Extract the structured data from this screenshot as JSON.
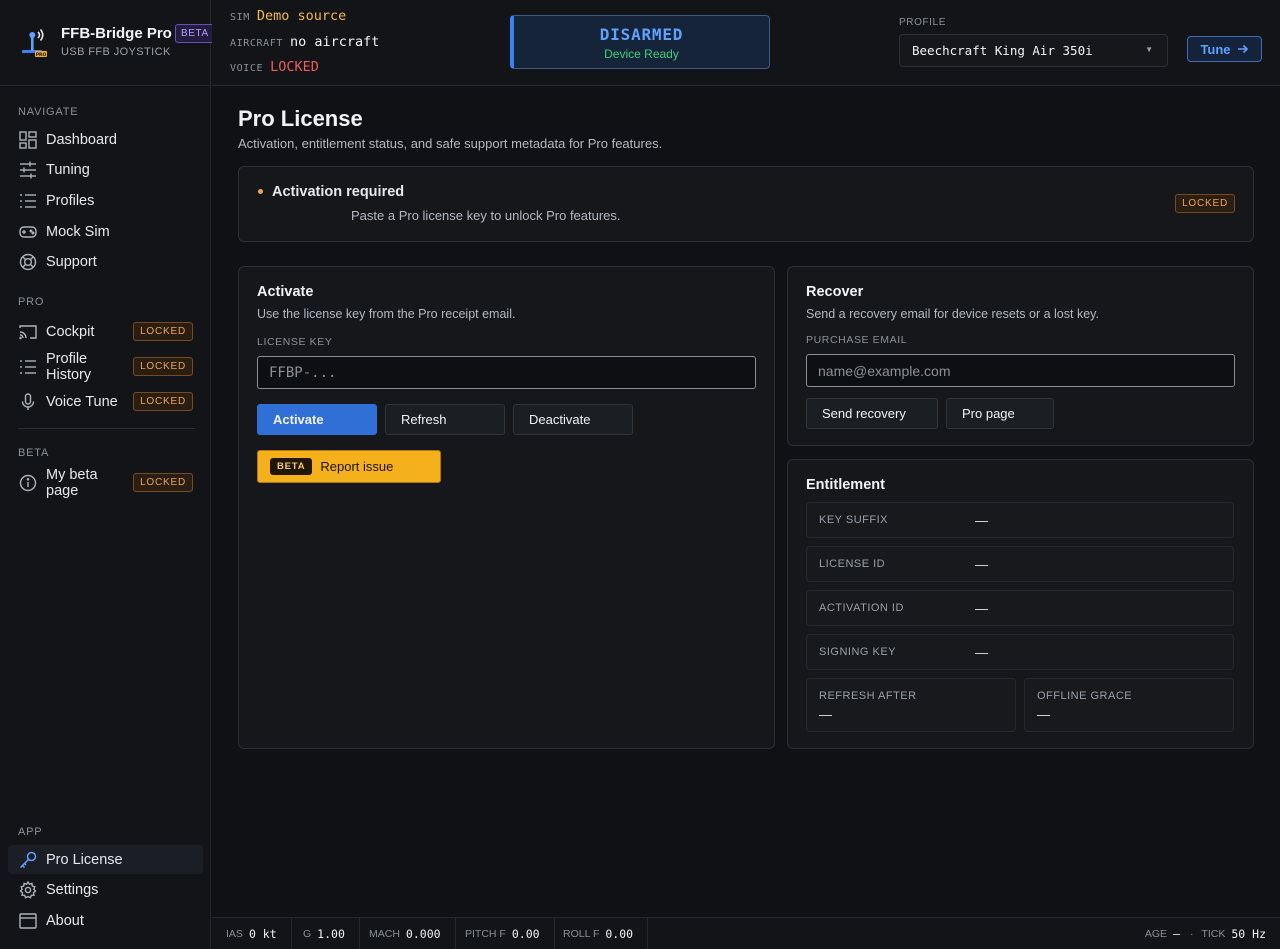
{
  "brand": {
    "name": "FFB-Bridge Pro",
    "badge": "BETA",
    "subtitle": "USB FFB JOYSTICK"
  },
  "sidebar": {
    "sections": {
      "navigate": "NAVIGATE",
      "pro": "PRO",
      "beta": "BETA",
      "app": "APP"
    },
    "navigate": [
      {
        "label": "Dashboard",
        "icon": "dashboard-icon"
      },
      {
        "label": "Tuning",
        "icon": "sliders-icon"
      },
      {
        "label": "Profiles",
        "icon": "list-icon"
      },
      {
        "label": "Mock Sim",
        "icon": "gamepad-icon"
      },
      {
        "label": "Support",
        "icon": "lifebuoy-icon"
      }
    ],
    "pro": [
      {
        "label": "Cockpit",
        "badge": "LOCKED",
        "icon": "cast-icon"
      },
      {
        "label": "Profile History",
        "badge": "LOCKED",
        "icon": "list-icon"
      },
      {
        "label": "Voice Tune",
        "badge": "LOCKED",
        "icon": "microphone-icon"
      }
    ],
    "beta": [
      {
        "label": "My beta page",
        "badge": "LOCKED",
        "icon": "info-icon"
      }
    ],
    "app": [
      {
        "label": "Pro License",
        "icon": "key-icon",
        "active": true
      },
      {
        "label": "Settings",
        "icon": "gear-icon"
      },
      {
        "label": "About",
        "icon": "window-icon"
      }
    ]
  },
  "topbar": {
    "sim_key": "SIM",
    "sim_value": "Demo source",
    "aircraft_key": "AIRCRAFT",
    "aircraft_value": "no aircraft",
    "voice_key": "VOICE",
    "voice_value": "LOCKED",
    "status": "DISARMED",
    "status_sub": "Device Ready",
    "profile_label": "PROFILE",
    "profile_value": "Beechcraft King Air 350i",
    "tune_label": "Tune"
  },
  "page": {
    "title": "Pro License",
    "subtitle": "Activation, entitlement status, and safe support metadata for Pro features."
  },
  "alert": {
    "title": "Activation required",
    "text": "Paste a Pro license key to unlock Pro features.",
    "badge": "LOCKED"
  },
  "activate": {
    "title": "Activate",
    "subtitle": "Use the license key from the Pro receipt email.",
    "field_label": "LICENSE KEY",
    "placeholder": "FFBP-...",
    "value": "",
    "buttons": {
      "activate": "Activate",
      "refresh": "Refresh",
      "deactivate": "Deactivate"
    },
    "beta_chip": "BETA",
    "report_label": "Report issue"
  },
  "recover": {
    "title": "Recover",
    "subtitle": "Send a recovery email for device resets or a lost key.",
    "field_label": "PURCHASE EMAIL",
    "placeholder": "name@example.com",
    "value": "",
    "buttons": {
      "send": "Send recovery",
      "pro_page": "Pro page"
    }
  },
  "entitlement": {
    "title": "Entitlement",
    "rows": [
      {
        "key": "KEY SUFFIX",
        "value": "—"
      },
      {
        "key": "LICENSE ID",
        "value": "—"
      },
      {
        "key": "ACTIVATION ID",
        "value": "—"
      },
      {
        "key": "SIGNING KEY",
        "value": "—"
      }
    ],
    "refresh_after": {
      "key": "REFRESH AFTER",
      "value": "—"
    },
    "offline_grace": {
      "key": "OFFLINE GRACE",
      "value": "—"
    }
  },
  "footer": {
    "ias": {
      "key": "IAS",
      "value": "0 kt"
    },
    "g": {
      "key": "G",
      "value": "1.00"
    },
    "mach": {
      "key": "MACH",
      "value": "0.000"
    },
    "pitch": {
      "key": "PITCH F",
      "value": "0.00"
    },
    "roll": {
      "key": "ROLL F",
      "value": "0.00"
    },
    "age": {
      "key": "AGE",
      "value": "—"
    },
    "sep": "·",
    "tick": {
      "key": "TICK",
      "value": "50 Hz"
    }
  },
  "colors": {
    "accent": "#3b82f6",
    "locked": "#f0a455",
    "ready": "#3ecf7a",
    "voice_locked": "#f05a5a",
    "sim_value": "#f5b94a",
    "beta_button": "#f5b11c"
  }
}
